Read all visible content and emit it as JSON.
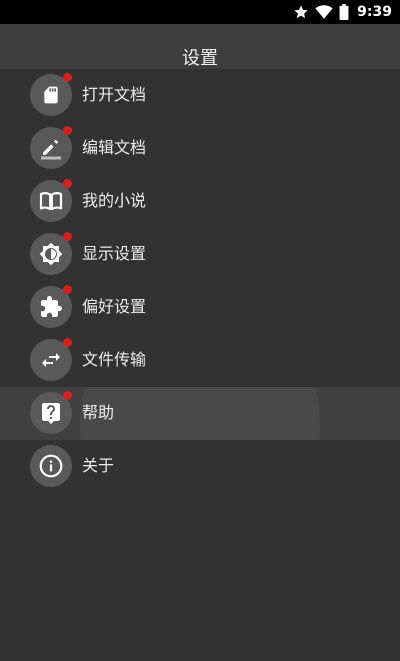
{
  "status_bar": {
    "time": "9:39",
    "icons": [
      "star-icon",
      "wifi-icon",
      "battery-icon"
    ]
  },
  "header": {
    "title": "设置"
  },
  "menu": {
    "items": [
      {
        "label": "打开文档",
        "icon": "sd-card-icon",
        "badge": true
      },
      {
        "label": "编辑文档",
        "icon": "pencil-icon",
        "badge": true
      },
      {
        "label": "我的小说",
        "icon": "book-icon",
        "badge": true
      },
      {
        "label": "显示设置",
        "icon": "brightness-icon",
        "badge": true
      },
      {
        "label": "偏好设置",
        "icon": "puzzle-icon",
        "badge": true
      },
      {
        "label": "文件传输",
        "icon": "transfer-icon",
        "badge": true
      },
      {
        "label": "帮助",
        "icon": "help-icon",
        "badge": true,
        "highlighted": true
      },
      {
        "label": "关于",
        "icon": "info-icon",
        "badge": false
      }
    ]
  },
  "colors": {
    "background": "#323232",
    "title_bar": "#3d3d3d",
    "icon_circle": "#595959",
    "badge": "#d32020",
    "highlight": "#404040"
  }
}
